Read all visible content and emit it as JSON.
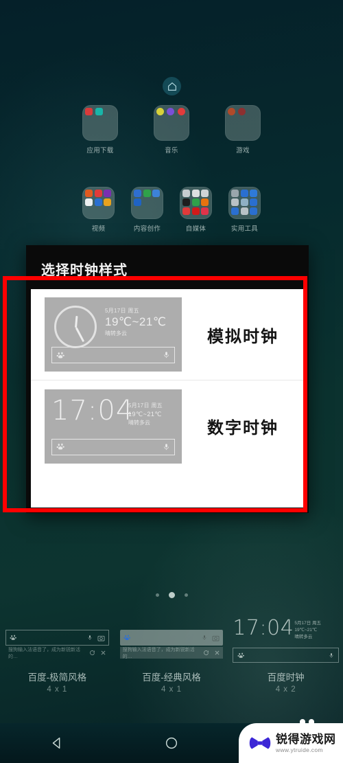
{
  "colors": {
    "wallpaper_dark": "#04212b",
    "sheet_bg": "#0a0a0a",
    "list_bg": "#ffffff",
    "highlight_red": "#ff0000",
    "preview_gray": "#adadad",
    "watermark_blue": "#3b26d6"
  },
  "home": {
    "home_icon": "home-icon",
    "folders_row1": [
      {
        "label": "应用下载",
        "icons": [
          "#d93b3b",
          "#19b5a8"
        ]
      },
      {
        "label": "音乐",
        "icons": [
          "#d8d13a",
          "#7b4fd6",
          "#e23b3b"
        ]
      },
      {
        "label": "游戏",
        "icons": [
          "#b04a2a",
          "#8c3030"
        ]
      }
    ],
    "folders_row2": [
      {
        "label": "视频",
        "icons": [
          "#e05a20",
          "#e03a3a",
          "#7a2fb0",
          "#f2f2f2",
          "#2a6fd0",
          "#e8a21e"
        ]
      },
      {
        "label": "内容创作",
        "icons": [
          "#2f6fd0",
          "#2fa24a",
          "#3d82d8",
          "#1f63c4"
        ]
      },
      {
        "label": "自媒体",
        "icons": [
          "#c8cdd0",
          "#dcdfe0",
          "#cfd4d6",
          "#1d1d1d",
          "#2fa24a",
          "#e8730f",
          "#e03a3a",
          "#d01a1a",
          "#e0334a"
        ]
      },
      {
        "label": "实用工具",
        "icons": [
          "#9aa6ac",
          "#2a6fd0",
          "#2f7ad8",
          "#b9c2c6",
          "#8fb0c4",
          "#2a6fd0",
          "#2a6fd0",
          "#b9c2c6",
          "#2a6fd0"
        ]
      }
    ],
    "page_dots": {
      "count": 3,
      "active_index": 1
    }
  },
  "dialog": {
    "title": "选择时钟样式",
    "options": [
      {
        "label": "模拟时钟",
        "type": "analog",
        "preview": {
          "date": "5月17日 周五",
          "temp": "19℃~21℃",
          "condition": "晴转多云",
          "search_left_icon": "baidu-paw-icon",
          "search_right_icon": "microphone-icon"
        }
      },
      {
        "label": "数字时钟",
        "type": "digital",
        "preview": {
          "time": "17:04",
          "date": "5月17日 周五",
          "temp": "19℃~21℃",
          "condition": "晴转多云",
          "search_left_icon": "baidu-paw-icon",
          "search_right_icon": "microphone-icon"
        }
      }
    ]
  },
  "widget_picker": {
    "items": [
      {
        "name": "百度-极简风格",
        "size": "4 x 1",
        "style": "simple",
        "left_icon": "baidu-paw-icon",
        "right_icons": [
          "microphone-icon",
          "camera-icon"
        ],
        "suggest_text": "搜狗输入法语音了，成为新锐新活的…",
        "sub_icons": [
          "refresh-icon",
          "close-icon"
        ]
      },
      {
        "name": "百度-经典风格",
        "size": "4 x 1",
        "style": "classic",
        "left_icon": "baidu-paw-icon",
        "right_icons": [
          "microphone-icon",
          "camera-icon"
        ],
        "suggest_text": "搜狗输入法语音了，成为新锐新活的…",
        "sub_icons": [
          "refresh-icon",
          "close-icon"
        ]
      },
      {
        "name": "百度时钟",
        "size": "4 x 2",
        "style": "clock",
        "time": "17:04",
        "date": "5月17日 周五",
        "temp": "19℃~21℃",
        "condition": "晴转多云",
        "left_icon": "baidu-paw-icon",
        "right_icons": [
          "microphone-icon"
        ]
      }
    ]
  },
  "navbar": {
    "buttons": [
      {
        "name": "back-button",
        "icon": "triangle-left-icon"
      },
      {
        "name": "home-button",
        "icon": "circle-icon"
      },
      {
        "name": "recents-button",
        "icon": "square-icon"
      }
    ]
  },
  "watermark": {
    "title": "锐得游戏网",
    "url": "www.ytruide.com",
    "icon": "gamepad-icon"
  }
}
